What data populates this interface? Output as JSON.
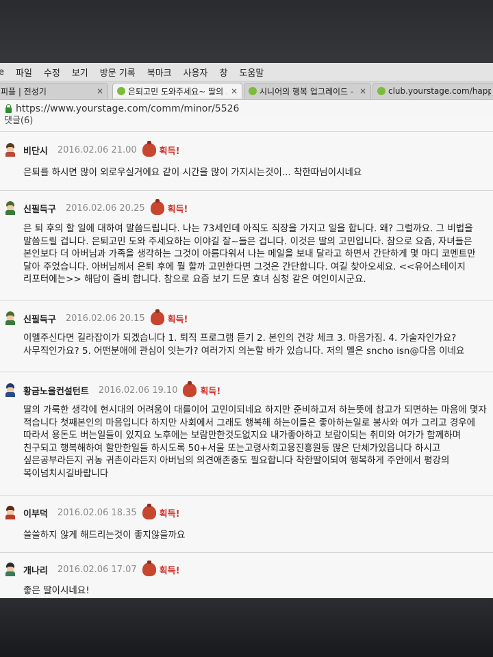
{
  "menu": [
    "e",
    "파일",
    "수정",
    "보기",
    "방문 기록",
    "북마크",
    "사용자",
    "창",
    "도움말"
  ],
  "tabs": [
    {
      "title": "피플 | 전성기",
      "close": "×"
    },
    {
      "title": "은퇴고민 도와주세요~ 딸의 고민",
      "close": "×"
    },
    {
      "title": "시니어의 행복 업그레이드 - 위",
      "close": "×"
    },
    {
      "title": "club.yourstage.com/happ",
      "close": ""
    }
  ],
  "url": "https://www.yourstage.com/comm/minor/5526",
  "comments_label": "댓글(6)",
  "award_label": "획득!",
  "comments": [
    {
      "name": "비단시",
      "date": "2016.02.06 21.00",
      "text": "은퇴를 하시면 많이 외로우실거에요 같이 시간을 많이 가지시는것이... 착한따님이시네요"
    },
    {
      "name": "신필득구",
      "date": "2016.02.06 20.25",
      "text": "은 퇴 후의 할 일에 대하여 말씀드립니다. 나는 73세인데 아직도 직장을 가지고 일을 합니다. 왜? 그럴까요. 그 비법을 말씀드릴 겁니다. 은퇴고민 도와 주세요하는 이야길 잘~들은 겁니다. 이것은 딸의 고민입니다. 참으로 요즘, 자녀들은 본인보다 더 아버님과 가족을 생각하는 그것이 아름다워서 나는 메일을 보내 달라고 하면서 간단하게 몇 마디 코멘트만 달아 주었습니다. 아버님께서 은퇴 후에 뭘 할까 고민한다면 그것은 간단합니다. 여길 찾아오세요. <<유어스테이지 리포터에는>> 해답이 즐비 합니다. 참으로 요즘 보기 드문 효녀 심청 같은 여인이시군요."
    },
    {
      "name": "신필득구",
      "date": "2016.02.06 20.15",
      "text": "이멜주신다면 길라잡이가 되겠습니다 1. 퇴직 프로그램 듣기 2. 본인의 건강 체크 3. 마음가짐. 4. 가술자인가요? 사무직인가요? 5. 어떤분애에 관심이 잇는가? 여러가지 의논할 바가 있습니다. 저의 멜은 sncho isn@다음 이네요"
    },
    {
      "name": "황금노을컨설턴트",
      "date": "2016.02.06 19.10",
      "text": "딸의 가룩한 생각에 현시대의 어려움이 대를이어 고민이되네요 하지만 준비하고저 하는뜻에 참고가 되면하는 마음에 몇자 적습니다 첫째본인의 마음입니다 하지만 사회에서 그래도 행복해 하는이들은 좋아하는일로 봉사와 여가 그리고 경우에 따라서 용돈도 버는일들이 있지요 노후에는 보람만한것도없지요 내가좋아하고 보람이되는 취미와 여가가 함께하며 친구되고 행복해하여 할만한일들 하시도록 50+서울 또는고령사회고용진흥원등 많은 단체가있읍니다 하시고 싶은공부라든지 귀농 귀촌이라든지 아버님의 의견애존중도 필요합니다 착한딸이되여 행복하게 주안에서 평강의 복이넘치시길바랍니다"
    },
    {
      "name": "이부덕",
      "date": "2016.02.06 18.35",
      "text": "쓸쓸하지 않게 해드리는것이 좋지않을까요"
    },
    {
      "name": "개나리",
      "date": "2016.02.06 17.07",
      "text": "좋은 딸이시네요!"
    }
  ],
  "colors": {
    "award": "#d0342c",
    "date": "#8a8a8a",
    "favicon": "#7dbb3a"
  }
}
